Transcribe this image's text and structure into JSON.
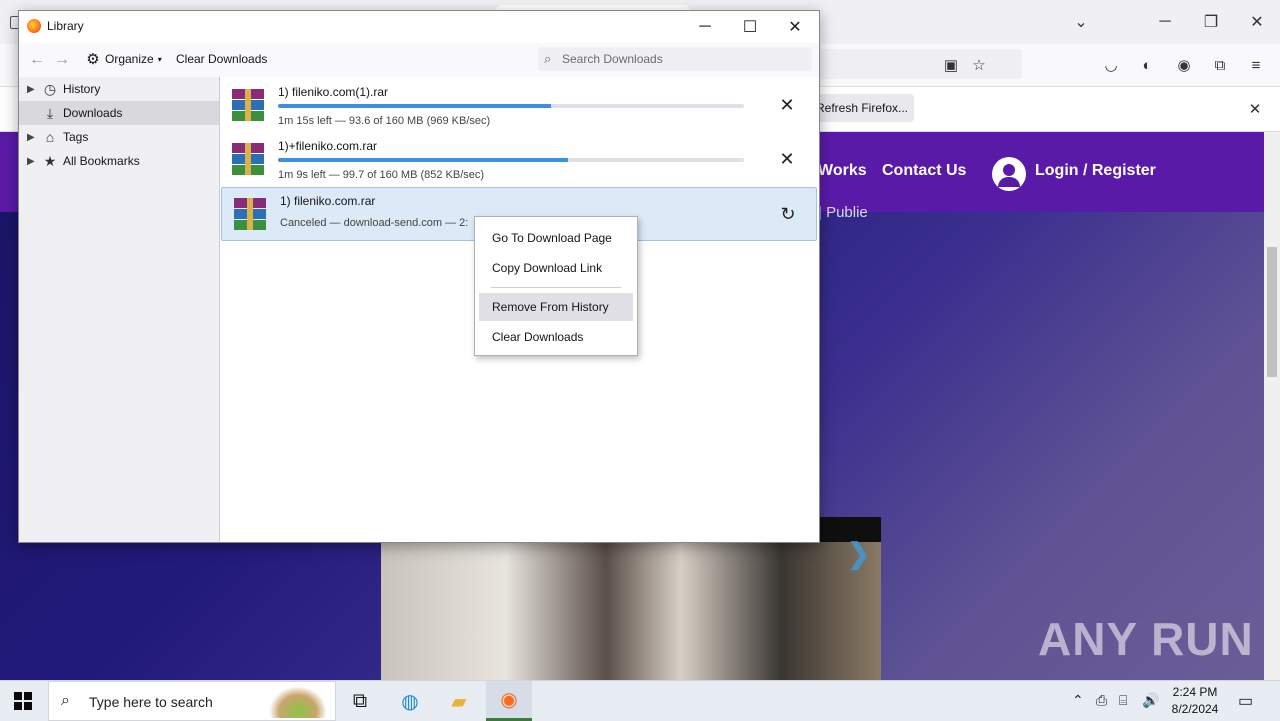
{
  "browser": {
    "refresh_label": "Refresh Firefox...",
    "nav_links": [
      "Works",
      "Contact Us"
    ],
    "login_label": "Login / Register",
    "fragment_text": "| Publie",
    "watermark": "ANY RUN"
  },
  "library": {
    "title": "Library",
    "toolbar": {
      "organize_label": "Organize",
      "clear_label": "Clear Downloads",
      "search_placeholder": "Search Downloads"
    },
    "sidebar": {
      "items": [
        {
          "label": "History",
          "icon": "clock-icon"
        },
        {
          "label": "Downloads",
          "icon": "download-icon"
        },
        {
          "label": "Tags",
          "icon": "tag-icon"
        },
        {
          "label": "All Bookmarks",
          "icon": "star-icon"
        }
      ]
    },
    "downloads": [
      {
        "name": "1) fileniko.com(1).rar",
        "status": "1m 15s left — 93.6 of 160 MB (969 KB/sec)",
        "progress": 0.585,
        "action": "cancel"
      },
      {
        "name": "1)+fileniko.com.rar",
        "status": "1m 9s left — 99.7 of 160 MB (852 KB/sec)",
        "progress": 0.623,
        "action": "cancel"
      },
      {
        "name": "1) fileniko.com.rar",
        "status": "Canceled — download-send.com — 2:",
        "progress": null,
        "action": "retry"
      }
    ],
    "context_menu": {
      "items": [
        "Go To Download Page",
        "Copy Download Link",
        "Remove From History",
        "Clear Downloads"
      ],
      "highlighted": "Remove From History"
    }
  },
  "taskbar": {
    "search_placeholder": "Type here to search",
    "time": "2:24 PM",
    "date": "8/2/2024"
  },
  "colors": {
    "page_nav": "#5a1aa8",
    "progress": "#3d8fe0",
    "selection": "#dce9f7"
  }
}
